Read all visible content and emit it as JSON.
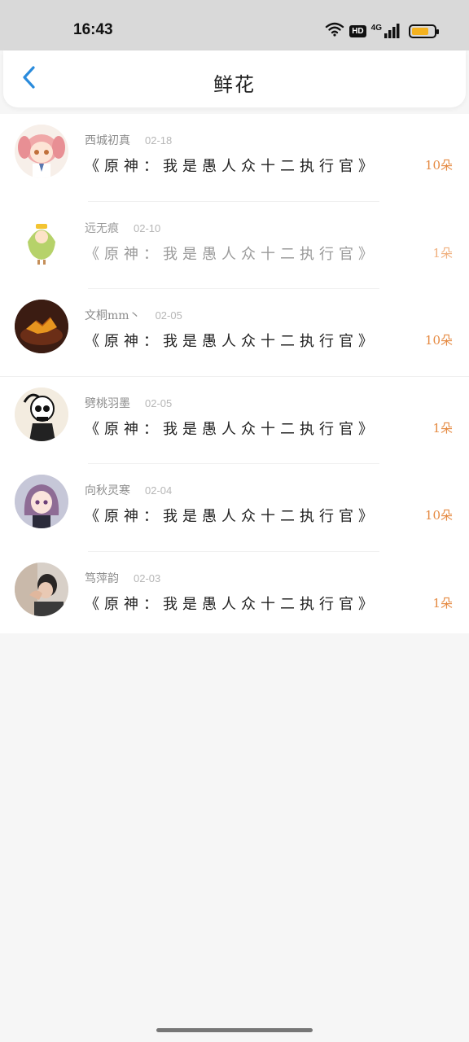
{
  "status_bar": {
    "time": "16:43",
    "hd_label": "HD",
    "network_label": "4G"
  },
  "header": {
    "title": "鲜花",
    "back_icon": "chevron-left-icon"
  },
  "colors": {
    "accent_blue": "#2a8bdc",
    "count_orange": "#e58a42",
    "battery_yellow": "#f4b21f"
  },
  "battery_level": 0.8,
  "gifts": [
    {
      "name": "西城初真",
      "date": "02-18",
      "title": "《原神：我是愚人众十二执行官》",
      "count": "10朵"
    },
    {
      "name": "远无痕",
      "date": "02-10",
      "title": "《原神：我是愚人众十二执行官》",
      "count": "1朵"
    },
    {
      "name": "文桐mm丶",
      "date": "02-05",
      "title": "《原神：我是愚人众十二执行官》",
      "count": "10朵"
    },
    {
      "name": "劈桃羽墨",
      "date": "02-05",
      "title": "《原神：我是愚人众十二执行官》",
      "count": "1朵"
    },
    {
      "name": "向秋灵寒",
      "date": "02-04",
      "title": "《原神：我是愚人众十二执行官》",
      "count": "10朵"
    },
    {
      "name": "笃萍韵",
      "date": "02-03",
      "title": "《原神：我是愚人众十二执行官》",
      "count": "1朵"
    }
  ]
}
